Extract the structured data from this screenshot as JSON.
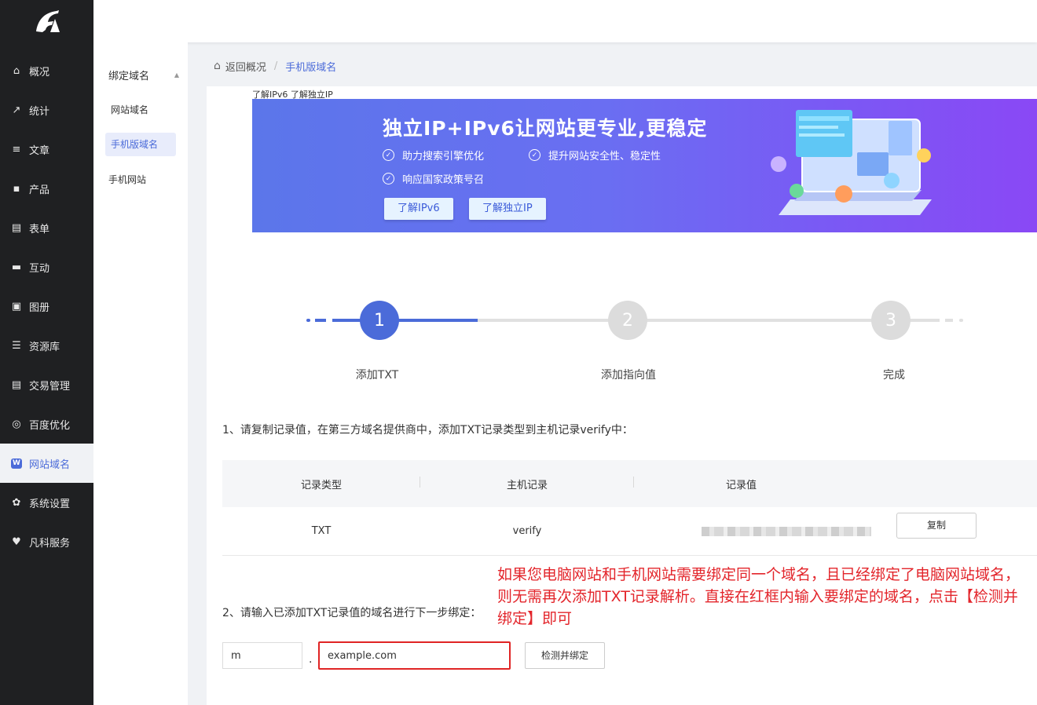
{
  "sidebar": {
    "items": [
      {
        "label": "概况",
        "icon": "home-icon",
        "glyph": "⌂"
      },
      {
        "label": "统计",
        "icon": "stats-icon",
        "glyph": "↗"
      },
      {
        "label": "文章",
        "icon": "article-icon",
        "glyph": "≡"
      },
      {
        "label": "产品",
        "icon": "product-icon",
        "glyph": "▪"
      },
      {
        "label": "表单",
        "icon": "form-icon",
        "glyph": "▤"
      },
      {
        "label": "互动",
        "icon": "chat-icon",
        "glyph": "▬"
      },
      {
        "label": "图册",
        "icon": "album-icon",
        "glyph": "▣"
      },
      {
        "label": "资源库",
        "icon": "database-icon",
        "glyph": "☰"
      },
      {
        "label": "交易管理",
        "icon": "trade-icon",
        "glyph": "▤"
      },
      {
        "label": "百度优化",
        "icon": "seo-icon",
        "glyph": "◎"
      },
      {
        "label": "网站域名",
        "icon": "domain-icon",
        "glyph": "W",
        "active": true
      },
      {
        "label": "系统设置",
        "icon": "gear-icon",
        "glyph": "✿"
      },
      {
        "label": "凡科服务",
        "icon": "heart-icon",
        "glyph": "♥"
      }
    ]
  },
  "subnav": {
    "header": "绑定域名",
    "items": [
      {
        "label": "网站域名"
      },
      {
        "label": "手机版域名",
        "active": true
      },
      {
        "label": "手机网站"
      }
    ]
  },
  "breadcrumb": {
    "back": "返回概况",
    "separator": "/",
    "current": "手机版域名"
  },
  "banner": {
    "links_text": "了解IPv6 了解独立IP",
    "title": "独立IP+IPv6让网站更专业,更稳定",
    "features": [
      "助力搜索引擎优化",
      "提升网站安全性、稳定性",
      "响应国家政策号召"
    ],
    "btn_ipv6": "了解IPv6",
    "btn_ip": "了解独立IP"
  },
  "steps": [
    {
      "num": "1",
      "label": "添加TXT",
      "active": true
    },
    {
      "num": "2",
      "label": "添加指向值",
      "active": false
    },
    {
      "num": "3",
      "label": "完成",
      "active": false
    }
  ],
  "instructions": {
    "step1": "1、请复制记录值，在第三方域名提供商中，添加TXT记录类型到主机记录verify中：",
    "step2": "2、请输入已添加TXT记录值的域名进行下一步绑定："
  },
  "table": {
    "headers": [
      "记录类型",
      "主机记录",
      "记录值"
    ],
    "row": {
      "type": "TXT",
      "host": "verify"
    },
    "copy_label": "复制"
  },
  "annotation": "如果您电脑网站和手机网站需要绑定同一个域名，且已经绑定了电脑网站域名，则无需再次添加TXT记录解析。直接在红框内输入要绑定的域名，点击【检测并绑定】即可",
  "form": {
    "prefix_value": "m",
    "dot": ".",
    "domain_value": "example.com",
    "check_label": "检测并绑定"
  },
  "colors": {
    "sidebar_bg": "#1f2022",
    "accent": "#4b6bd9",
    "annotation": "#e3252b",
    "highlight_border": "#e02424"
  }
}
